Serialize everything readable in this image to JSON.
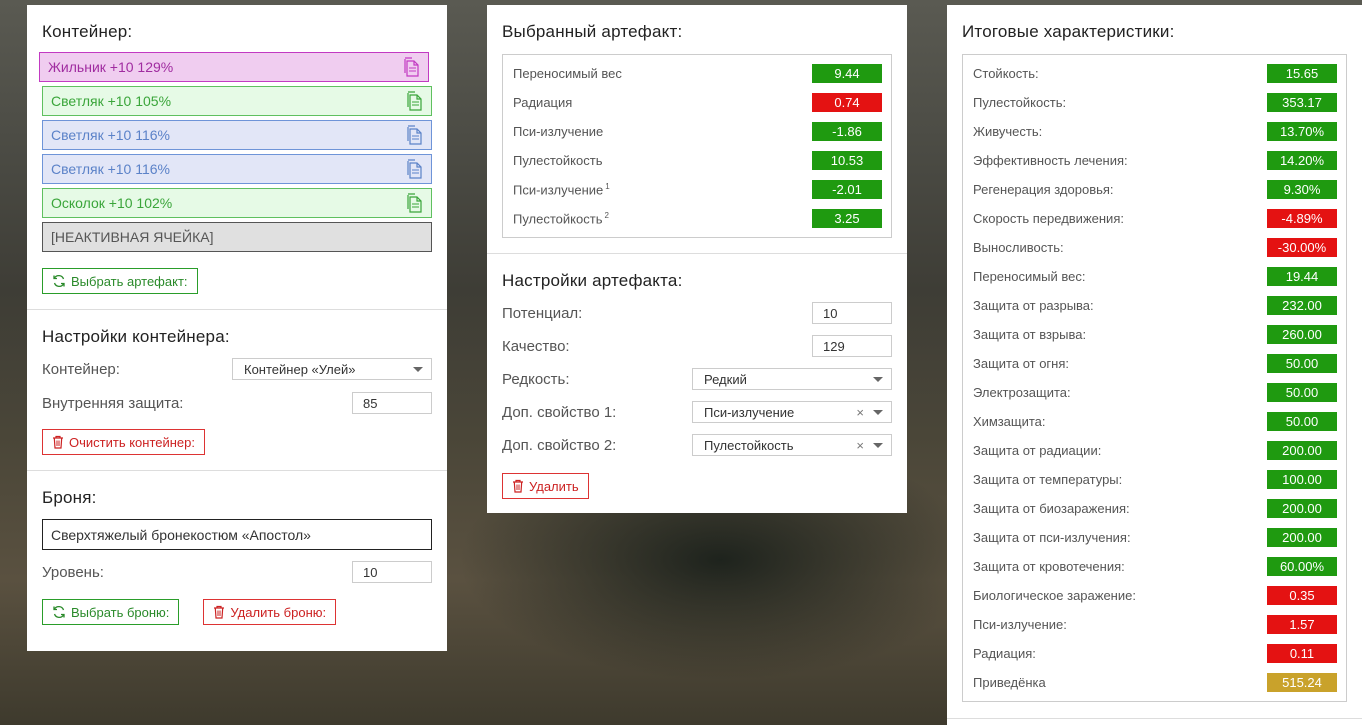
{
  "container_panel": {
    "title": "Контейнер:",
    "slots": [
      {
        "label": "Жильник +10 129%",
        "style": "purple"
      },
      {
        "label": "Светляк +10 105%",
        "style": "green"
      },
      {
        "label": "Светляк +10 116%",
        "style": "blue"
      },
      {
        "label": "Светляк +10 116%",
        "style": "blue"
      },
      {
        "label": "Осколок +10 102%",
        "style": "green"
      },
      {
        "label": "[НЕАКТИВНАЯ ЯЧЕЙКА]",
        "style": "gray"
      }
    ],
    "select_artifact_button": "Выбрать артефакт:",
    "settings_title": "Настройки контейнера:",
    "container_label": "Контейнер:",
    "container_value": "Контейнер «Улей»",
    "inner_protection_label": "Внутренняя защита:",
    "inner_protection_value": "85",
    "clear_button": "Очистить контейнер:",
    "armor_title": "Броня:",
    "armor_value": "Сверхтяжелый бронекостюм «Апостол»",
    "level_label": "Уровень:",
    "level_value": "10",
    "select_armor_button": "Выбрать броню:",
    "remove_armor_button": "Удалить броню:"
  },
  "artifact_panel": {
    "title": "Выбранный артефакт:",
    "stats": [
      {
        "label": "Переносимый вес",
        "sup": "",
        "value": "9.44",
        "color": "g"
      },
      {
        "label": "Радиация",
        "sup": "",
        "value": "0.74",
        "color": "r"
      },
      {
        "label": "Пси-излучение",
        "sup": "",
        "value": "-1.86",
        "color": "g"
      },
      {
        "label": "Пулестойкость",
        "sup": "",
        "value": "10.53",
        "color": "g"
      },
      {
        "label": "Пси-излучение",
        "sup": "1",
        "value": "-2.01",
        "color": "g"
      },
      {
        "label": "Пулестойкость",
        "sup": "2",
        "value": "3.25",
        "color": "g"
      }
    ],
    "settings_title": "Настройки артефакта:",
    "potential_label": "Потенциал:",
    "potential_value": "10",
    "quality_label": "Качество:",
    "quality_value": "129",
    "rarity_label": "Редкость:",
    "rarity_value": "Редкий",
    "extra1_label": "Доп. свойство 1:",
    "extra1_value": "Пси-излучение",
    "extra2_label": "Доп. свойство 2:",
    "extra2_value": "Пулестойкость",
    "clear_symbol": "×",
    "delete_button": "Удалить"
  },
  "totals_panel": {
    "title": "Итоговые характеристики:",
    "stats": [
      {
        "label": "Стойкость:",
        "value": "15.65",
        "color": "g"
      },
      {
        "label": "Пулестойкость:",
        "value": "353.17",
        "color": "g"
      },
      {
        "label": "Живучесть:",
        "value": "13.70%",
        "color": "g"
      },
      {
        "label": "Эффективность лечения:",
        "value": "14.20%",
        "color": "g"
      },
      {
        "label": "Регенерация здоровья:",
        "value": "9.30%",
        "color": "g"
      },
      {
        "label": "Скорость передвижения:",
        "value": "-4.89%",
        "color": "r"
      },
      {
        "label": "Выносливость:",
        "value": "-30.00%",
        "color": "r"
      },
      {
        "label": "Переносимый вес:",
        "value": "19.44",
        "color": "g"
      },
      {
        "label": "Защита от разрыва:",
        "value": "232.00",
        "color": "g"
      },
      {
        "label": "Защита от взрыва:",
        "value": "260.00",
        "color": "g"
      },
      {
        "label": "Защита от огня:",
        "value": "50.00",
        "color": "g"
      },
      {
        "label": "Электрозащита:",
        "value": "50.00",
        "color": "g"
      },
      {
        "label": "Химзащита:",
        "value": "50.00",
        "color": "g"
      },
      {
        "label": "Защита от радиации:",
        "value": "200.00",
        "color": "g"
      },
      {
        "label": "Защита от температуры:",
        "value": "100.00",
        "color": "g"
      },
      {
        "label": "Защита от биозаражения:",
        "value": "200.00",
        "color": "g"
      },
      {
        "label": "Защита от пси-излучения:",
        "value": "200.00",
        "color": "g"
      },
      {
        "label": "Защита от кровотечения:",
        "value": "60.00%",
        "color": "g"
      },
      {
        "label": "Биологическое заражение:",
        "value": "0.35",
        "color": "r"
      },
      {
        "label": "Пси-излучение:",
        "value": "1.57",
        "color": "r"
      },
      {
        "label": "Радиация:",
        "value": "0.11",
        "color": "r"
      },
      {
        "label": "Приведёнка",
        "value": "515.24",
        "color": "y"
      }
    ]
  },
  "icons": {
    "slot": "copy-icon",
    "refresh": "refresh-icon",
    "trash": "trash-icon",
    "dropdown": "chevron-down-icon"
  },
  "colors": {
    "positive": "#1f9a10",
    "negative": "#e41212",
    "summary": "#c9a22b"
  }
}
